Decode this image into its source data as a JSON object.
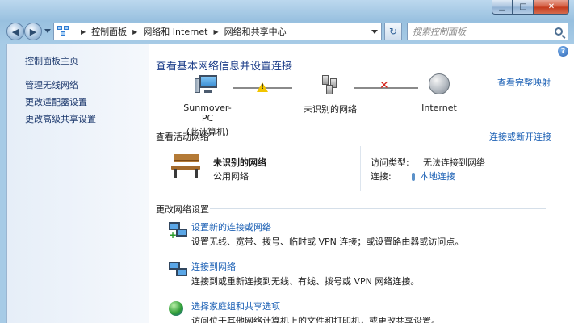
{
  "address": {
    "crumbs": [
      "控制面板",
      "网络和 Internet",
      "网络和共享中心"
    ],
    "search_placeholder": "搜索控制面板"
  },
  "leftnav": {
    "items": [
      "控制面板主页",
      "管理无线网络",
      "更改适配器设置",
      "更改高级共享设置"
    ]
  },
  "main": {
    "title": "查看基本网络信息并设置连接",
    "full_map_link": "查看完整映射",
    "map": {
      "computer_name": "Sunmover-PC",
      "computer_sub": "(此计算机)",
      "network": "未识别的网络",
      "internet": "Internet"
    },
    "active": {
      "heading": "查看活动网络",
      "link": "连接或断开连接",
      "network_name": "未识别的网络",
      "network_type": "公用网络",
      "access_label": "访问类型:",
      "access_value": "无法连接到网络",
      "conn_label": "连接:",
      "conn_value": "本地连接"
    },
    "change": {
      "heading": "更改网络设置",
      "tasks": [
        {
          "title": "设置新的连接或网络",
          "desc": "设置无线、宽带、拨号、临时或 VPN 连接；或设置路由器或访问点。"
        },
        {
          "title": "连接到网络",
          "desc": "连接到或重新连接到无线、有线、拨号或 VPN 网络连接。"
        },
        {
          "title": "选择家庭组和共享选项",
          "desc": "访问位于其他网络计算机上的文件和打印机，或更改共享设置。"
        }
      ]
    }
  }
}
